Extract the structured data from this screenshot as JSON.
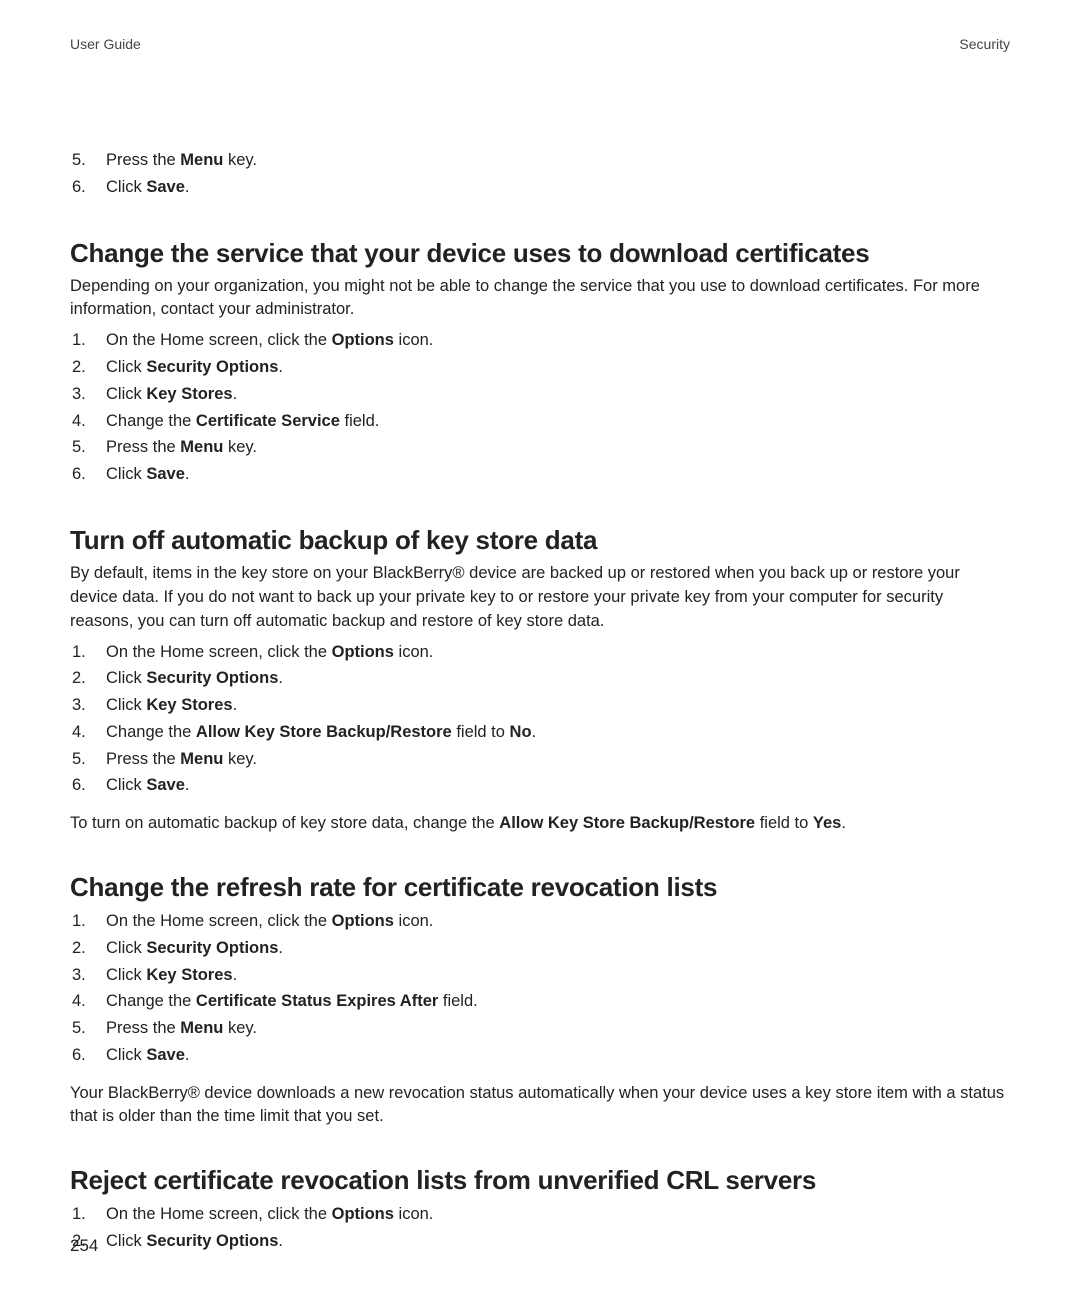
{
  "header": {
    "left": "User Guide",
    "right": "Security"
  },
  "intro_steps": [
    {
      "n": "5.",
      "parts": [
        "Press the ",
        "Menu",
        " key."
      ]
    },
    {
      "n": "6.",
      "parts": [
        "Click ",
        "Save",
        "."
      ]
    }
  ],
  "sections": [
    {
      "heading": "Change the service that your device uses to download certificates",
      "intro": "Depending on your organization, you might not be able to change the service that you use to download certificates. For more information, contact your administrator.",
      "steps": [
        {
          "n": "1.",
          "parts": [
            "On the Home screen, click the ",
            "Options",
            " icon."
          ]
        },
        {
          "n": "2.",
          "parts": [
            "Click ",
            "Security Options",
            "."
          ]
        },
        {
          "n": "3.",
          "parts": [
            "Click ",
            "Key Stores",
            "."
          ]
        },
        {
          "n": "4.",
          "parts": [
            "Change the ",
            "Certificate Service",
            " field."
          ]
        },
        {
          "n": "5.",
          "parts": [
            "Press the ",
            "Menu",
            " key."
          ]
        },
        {
          "n": "6.",
          "parts": [
            "Click ",
            "Save",
            "."
          ]
        }
      ]
    },
    {
      "heading": "Turn off automatic backup of key store data",
      "intro": "By default, items in the key store on your BlackBerry® device are backed up or restored when you back up or restore your device data. If you do not want to back up your private key to or restore your private key from your computer for security reasons, you can turn off automatic backup and restore of key store data.",
      "steps": [
        {
          "n": "1.",
          "parts": [
            "On the Home screen, click the ",
            "Options",
            " icon."
          ]
        },
        {
          "n": "2.",
          "parts": [
            "Click ",
            "Security Options",
            "."
          ]
        },
        {
          "n": "3.",
          "parts": [
            "Click ",
            "Key Stores",
            "."
          ]
        },
        {
          "n": "4.",
          "parts": [
            "Change the ",
            "Allow Key Store Backup/Restore",
            " field to ",
            "No",
            "."
          ]
        },
        {
          "n": "5.",
          "parts": [
            "Press the ",
            "Menu",
            " key."
          ]
        },
        {
          "n": "6.",
          "parts": [
            "Click ",
            "Save",
            "."
          ]
        }
      ],
      "followup": {
        "parts": [
          "To turn on automatic backup of key store data, change the ",
          "Allow Key Store Backup/Restore",
          " field to ",
          "Yes",
          "."
        ]
      }
    },
    {
      "heading": "Change the refresh rate for certificate revocation lists",
      "steps": [
        {
          "n": "1.",
          "parts": [
            "On the Home screen, click the ",
            "Options",
            " icon."
          ]
        },
        {
          "n": "2.",
          "parts": [
            "Click ",
            "Security Options",
            "."
          ]
        },
        {
          "n": "3.",
          "parts": [
            "Click ",
            "Key Stores",
            "."
          ]
        },
        {
          "n": "4.",
          "parts": [
            "Change the ",
            "Certificate Status Expires After",
            " field."
          ]
        },
        {
          "n": "5.",
          "parts": [
            "Press the ",
            "Menu",
            " key."
          ]
        },
        {
          "n": "6.",
          "parts": [
            "Click ",
            "Save",
            "."
          ]
        }
      ],
      "followup": {
        "parts": [
          "Your BlackBerry® device downloads a new revocation status automatically when your device uses a key store item with a status that is older than the time limit that you set."
        ]
      }
    },
    {
      "heading": "Reject certificate revocation lists from unverified CRL servers",
      "steps": [
        {
          "n": "1.",
          "parts": [
            "On the Home screen, click the ",
            "Options",
            " icon."
          ]
        },
        {
          "n": "2.",
          "parts": [
            "Click ",
            "Security Options",
            "."
          ]
        }
      ]
    }
  ],
  "page_number": "254"
}
